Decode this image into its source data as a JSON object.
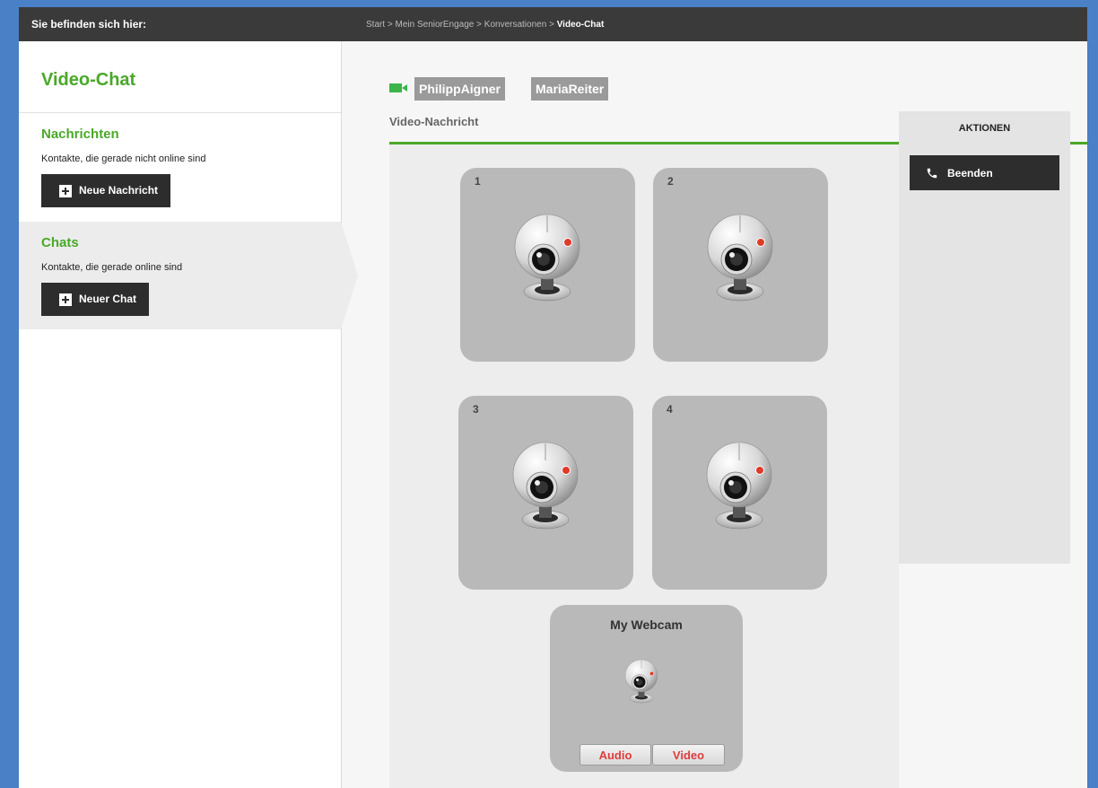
{
  "topbar": {
    "where_label": "Sie befinden sich hier:",
    "breadcrumb": [
      "Start",
      "Mein SeniorEngage",
      "Konversationen",
      "Video-Chat"
    ],
    "separator": ">"
  },
  "sidebar": {
    "title": "Video-Chat",
    "sections": [
      {
        "heading": "Nachrichten",
        "description": "Kontakte, die gerade nicht online sind",
        "button": "Neue Nachricht"
      },
      {
        "heading": "Chats",
        "description": "Kontakte, die gerade online sind",
        "button": "Neuer Chat"
      }
    ]
  },
  "main": {
    "participants": [
      "PhilippAigner",
      "MariaReiter"
    ],
    "subtitle": "Video-Nachricht",
    "tiles": [
      "1",
      "2",
      "3",
      "4"
    ],
    "my_webcam": {
      "label": "My Webcam",
      "audio": "Audio",
      "video": "Video"
    }
  },
  "actions": {
    "heading": "AKTIONEN",
    "end_button": "Beenden"
  },
  "colors": {
    "accent": "#4aa829",
    "video_icon": "#3cb44a",
    "dark": "#2d2d2d",
    "toggle_text": "#e03c3c"
  }
}
